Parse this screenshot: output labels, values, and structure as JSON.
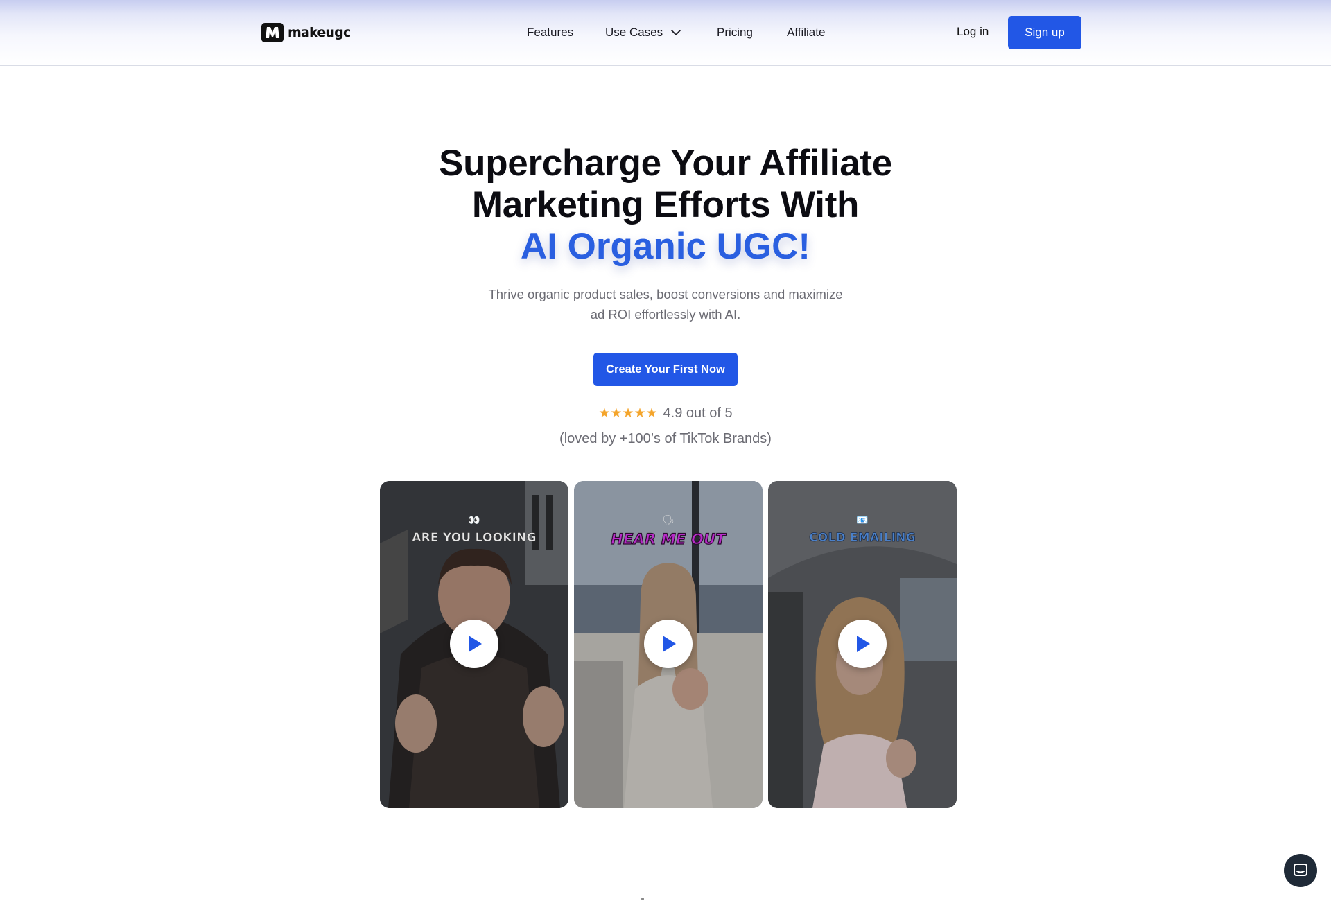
{
  "header": {
    "logo_text": "makeugc",
    "nav": {
      "features": "Features",
      "use_cases": "Use Cases",
      "pricing": "Pricing",
      "affiliate": "Affiliate"
    },
    "login": "Log in",
    "signup": "Sign up"
  },
  "hero": {
    "title_line1": "Supercharge Your Affiliate",
    "title_line2": "Marketing Efforts With",
    "title_accent": "AI Organic UGC!",
    "subtitle_line1": "Thrive organic product sales, boost conversions and maximize",
    "subtitle_line2": "ad ROI effortlessly with AI.",
    "cta": "Create Your First Now",
    "rating_stars": "★★★★★",
    "rating_text": "4.9 out of 5",
    "loved_text": "(loved by +100’s of TikTok Brands)"
  },
  "videos": [
    {
      "caption": "ARE YOU LOOKING",
      "emoji": "👀"
    },
    {
      "caption": "HEAR ME OUT",
      "emoji": "🗣"
    },
    {
      "caption": "COLD EMAILING",
      "emoji": "📧"
    }
  ],
  "colors": {
    "primary": "#2257e6",
    "accent_text": "#2a5fe0",
    "star": "#f4a52c",
    "muted_text": "#6b6b73"
  },
  "icons": {
    "logo": "makeugc-logo-icon",
    "dropdown": "chevron-down-icon",
    "play": "play-icon",
    "chat": "chat-icon"
  }
}
